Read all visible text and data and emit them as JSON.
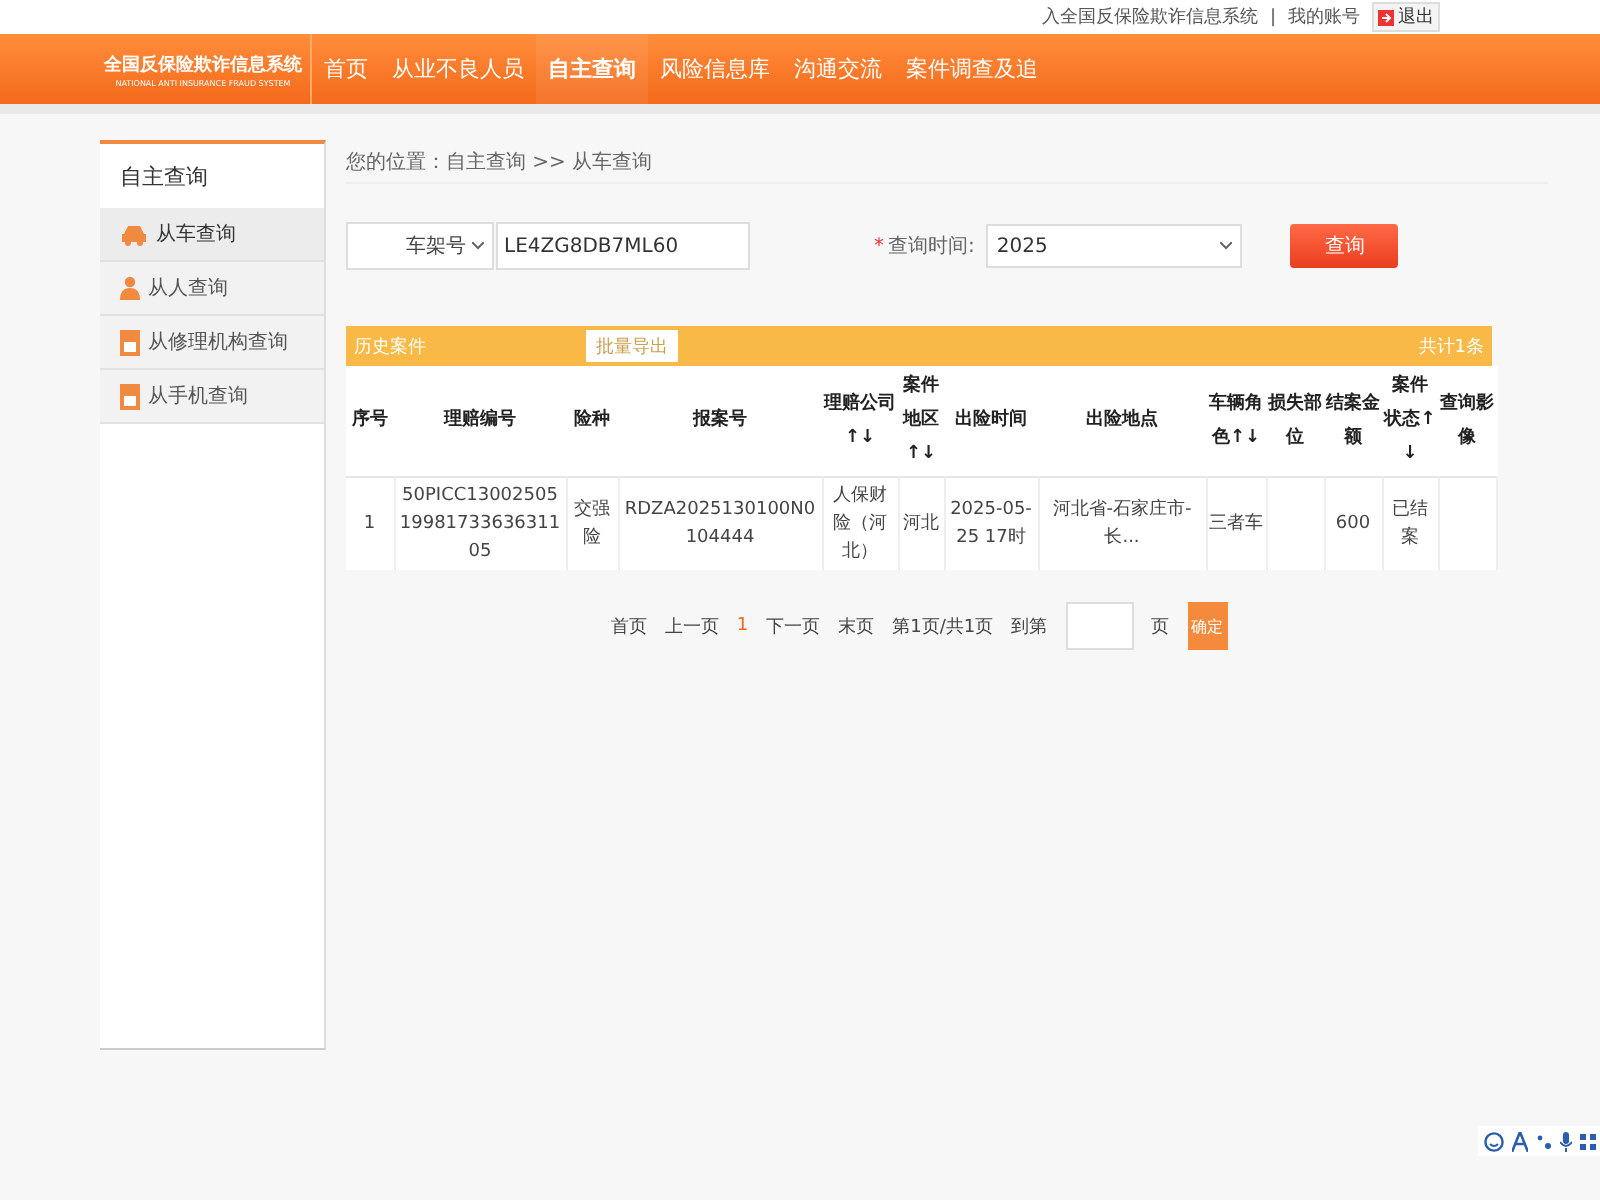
{
  "top_links": {
    "system_link": "入全国反保险欺诈信息系统",
    "separator": "|",
    "account": "我的账号",
    "logout": "退出"
  },
  "header": {
    "logo_title": "全国反保险欺诈信息系统",
    "logo_subtitle": "NATIONAL ANTI INSURANCE FRAUD SYSTEM",
    "nav": [
      {
        "label": "首页",
        "selected": false
      },
      {
        "label": "从业不良人员",
        "selected": false
      },
      {
        "label": "自主查询",
        "selected": true
      },
      {
        "label": "风险信息库",
        "selected": false
      },
      {
        "label": "沟通交流",
        "selected": false
      },
      {
        "label": "案件调查及追",
        "selected": false
      }
    ]
  },
  "sidebar": {
    "title": "自主查询",
    "items": [
      {
        "label": "从车查询",
        "kind": "car",
        "selected": true
      },
      {
        "label": "从人查询",
        "kind": "person",
        "selected": false
      },
      {
        "label": "从修理机构查询",
        "kind": "doc",
        "selected": false
      },
      {
        "label": "从手机查询",
        "kind": "doc",
        "selected": false
      }
    ]
  },
  "breadcrumb": "您的位置：自主查询 >> 从车查询",
  "search": {
    "type_select": "车架号",
    "vin_value": "LE4ZG8DB7ML60",
    "time_label": "查询时间:",
    "required_mark": "*",
    "time_select": "2025",
    "submit": "查询"
  },
  "results": {
    "title": "历史案件",
    "export_button": "批量导出",
    "total": "共计1条",
    "columns": [
      "序号",
      "理赔编号",
      "险种",
      "报案号",
      "理赔公司↑↓",
      "案件地区↑↓",
      "出险时间",
      "出险地点",
      "车辆角色↑↓",
      "损失部位",
      "结案金额",
      "案件状态↑↓",
      "查询影像"
    ],
    "rows": [
      {
        "cells": [
          "1",
          "50PICC130025051998173363631105",
          "交强险",
          "RDZA2025130100N0104444",
          "人保财险（河北）",
          "河北",
          "2025-05-25 17时",
          "河北省-石家庄市-长...",
          "三者车",
          null,
          "600",
          "已结案",
          null
        ]
      }
    ]
  },
  "pagination": {
    "first": "首页",
    "prev": "上一页",
    "pages": [
      {
        "label": "1",
        "selected": true
      }
    ],
    "next": "下一页",
    "last": "末页",
    "info": "第1页/共1页",
    "goto_label": "到第",
    "page_unit": "页",
    "confirm": "确定"
  }
}
